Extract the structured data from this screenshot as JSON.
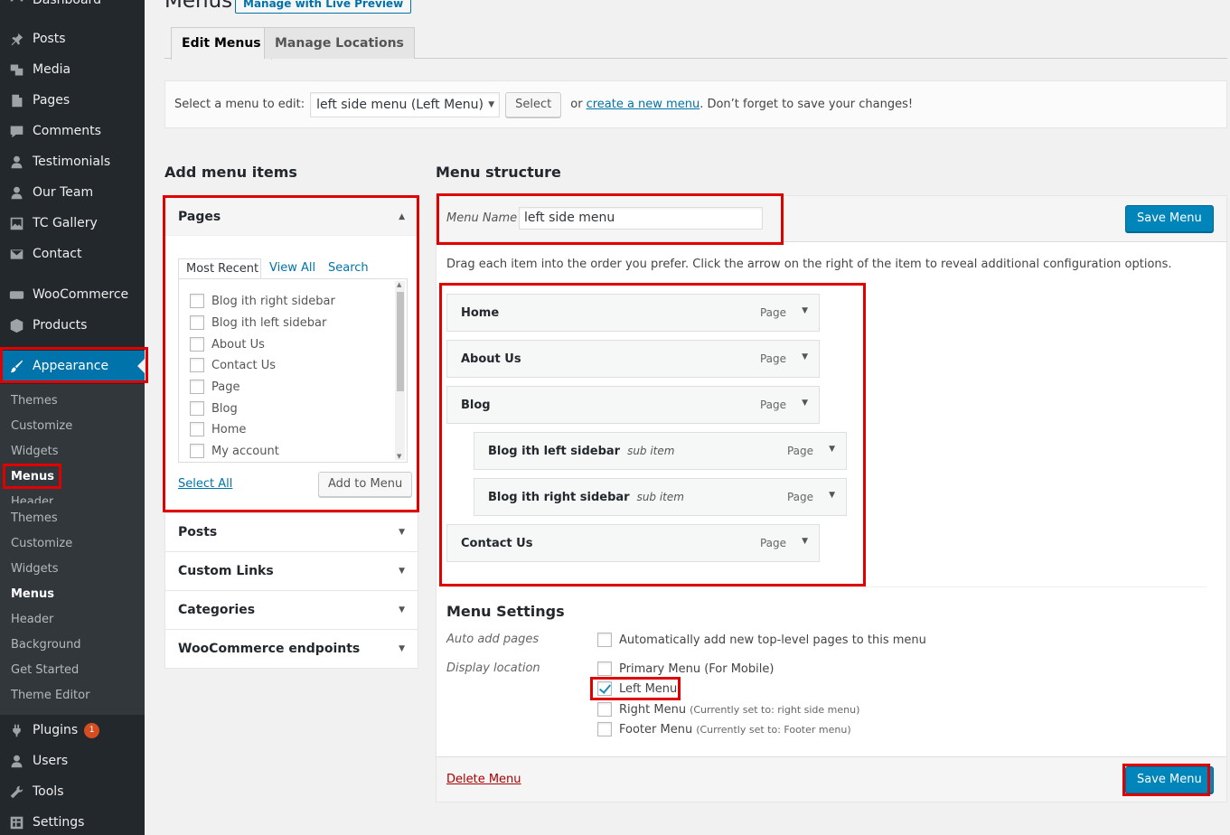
{
  "sidebar": {
    "items_top": [
      {
        "label": "Dashboard",
        "icon": "dashboard-icon"
      },
      {
        "label": "Posts",
        "icon": "pin-icon"
      },
      {
        "label": "Media",
        "icon": "media-icon"
      },
      {
        "label": "Pages",
        "icon": "pages-icon"
      },
      {
        "label": "Comments",
        "icon": "comment-icon"
      },
      {
        "label": "Testimonials",
        "icon": "person-icon"
      },
      {
        "label": "Our Team",
        "icon": "person-icon"
      },
      {
        "label": "TC Gallery",
        "icon": "gallery-icon"
      },
      {
        "label": "Contact",
        "icon": "mail-icon"
      },
      {
        "label": "WooCommerce",
        "icon": "woo-icon"
      },
      {
        "label": "Products",
        "icon": "cube-icon"
      },
      {
        "label": "Appearance",
        "icon": "brush-icon"
      }
    ],
    "submenu": [
      "Themes",
      "Customize",
      "Widgets",
      "Menus",
      "Header",
      "Themes",
      "Customize",
      "Widgets",
      "Menus",
      "Header",
      "Background",
      "Get Started",
      "Theme Editor"
    ],
    "items_bottom": [
      {
        "label": "Plugins",
        "icon": "plugin-icon",
        "badge": "1"
      },
      {
        "label": "Users",
        "icon": "person-icon"
      },
      {
        "label": "Tools",
        "icon": "wrench-icon"
      },
      {
        "label": "Settings",
        "icon": "settings-icon"
      }
    ]
  },
  "header": {
    "title": "Menus",
    "live_preview": "Manage with Live Preview",
    "tabs": [
      "Edit Menus",
      "Manage Locations"
    ]
  },
  "select_bar": {
    "label": "Select a menu to edit:",
    "selected": "left side menu (Left Menu)",
    "select_button": "Select",
    "or": "or",
    "create_link": "create a new menu",
    "suffix": ". Don’t forget to save your changes!"
  },
  "add_items": {
    "title": "Add menu items",
    "pages": {
      "title": "Pages",
      "tabs": [
        "Most Recent",
        "View All",
        "Search"
      ],
      "items": [
        "Blog ith right sidebar",
        "Blog ith left sidebar",
        "About Us",
        "Contact Us",
        "Page",
        "Blog",
        "Home",
        "My account"
      ],
      "select_all": "Select All",
      "add_button": "Add to Menu"
    },
    "other_panels": [
      "Posts",
      "Custom Links",
      "Categories",
      "WooCommerce endpoints"
    ]
  },
  "structure": {
    "title": "Menu structure",
    "name_label": "Menu Name",
    "name_value": "left side menu",
    "save_button": "Save Menu",
    "instructions": "Drag each item into the order you prefer. Click the arrow on the right of the item to reveal additional configuration options.",
    "items": [
      {
        "title": "Home",
        "sub": "",
        "type": "Page"
      },
      {
        "title": "About Us",
        "sub": "",
        "type": "Page"
      },
      {
        "title": "Blog",
        "sub": "",
        "type": "Page"
      },
      {
        "title": "Blog ith left sidebar",
        "sub": "sub item",
        "type": "Page"
      },
      {
        "title": "Blog ith right sidebar",
        "sub": "sub item",
        "type": "Page"
      },
      {
        "title": "Contact Us",
        "sub": "",
        "type": "Page"
      }
    ]
  },
  "settings": {
    "title": "Menu Settings",
    "auto_add_label": "Auto add pages",
    "auto_add_option": "Automatically add new top-level pages to this menu",
    "display_label": "Display location",
    "locations": [
      {
        "label": "Primary Menu (For Mobile)",
        "note": "",
        "checked": false
      },
      {
        "label": "Left Menu",
        "note": "",
        "checked": true
      },
      {
        "label": "Right Menu",
        "note": "(Currently set to: right side menu)",
        "checked": false
      },
      {
        "label": "Footer Menu",
        "note": "(Currently set to: Footer menu)",
        "checked": false
      }
    ],
    "delete_link": "Delete Menu",
    "save_button": "Save Menu"
  },
  "colors": {
    "sidebar_bg": "#23282d",
    "submenu_bg": "#32373c",
    "active_blue": "#0073aa",
    "primary_button": "#0085ba",
    "highlight_red": "#e00000",
    "badge": "#d54e21"
  }
}
